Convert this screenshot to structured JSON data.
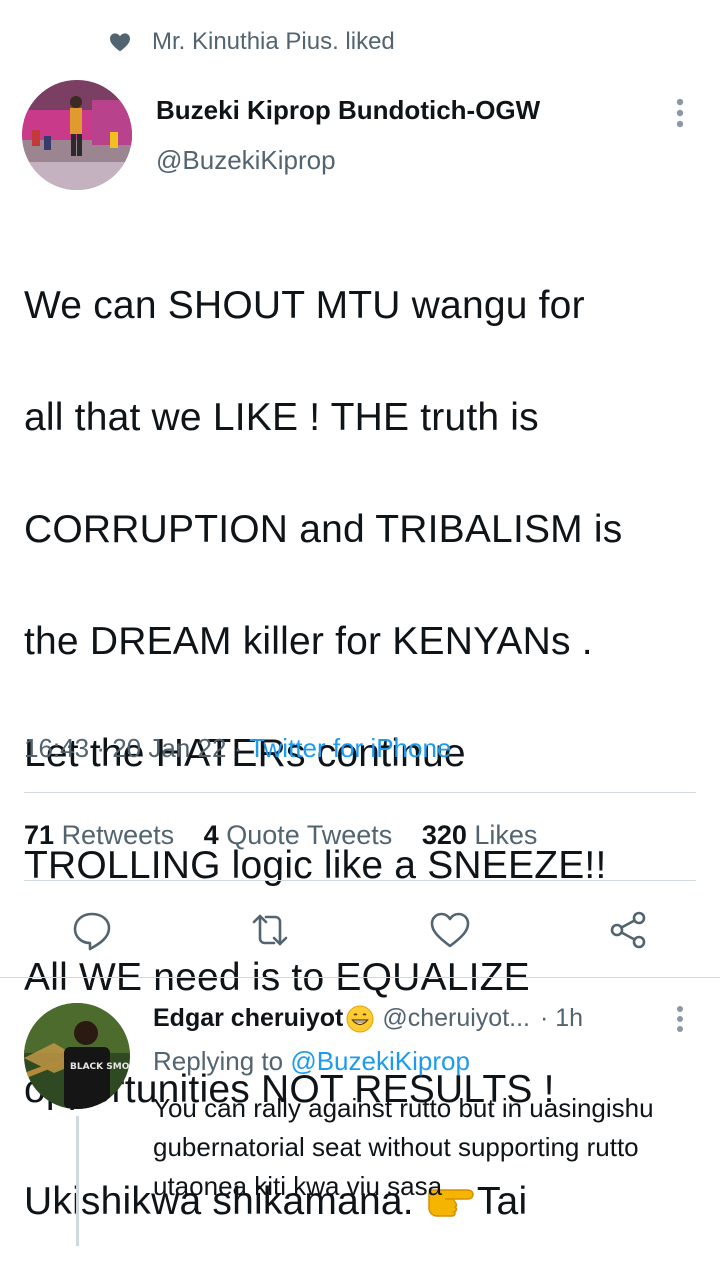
{
  "social_context": {
    "text": "Mr. Kinuthia Pius. liked"
  },
  "tweet": {
    "author_name": "Buzeki Kiprop Bundotich-OGW",
    "author_handle": "@BuzekiKiprop",
    "text_lines": [
      "We can SHOUT  MTU wangu  for",
      "all that we LIKE  ! THE truth is",
      "CORRUPTION  and TRIBALISM is",
      "the  DREAM killer for KENYANs .",
      "Let the HATERs  continue",
      "TROLLING logic  like a SNEEZE!!",
      "All WE need  is to EQUALIZE",
      "opportunities NOT RESULTS !",
      "Ukishikwa  shikamana. "
    ],
    "text_tail": "Tai",
    "time": "16:43",
    "date": "20 Jan 22",
    "source": "Twitter for iPhone",
    "retweets_count": "71",
    "retweets_label": "Retweets",
    "quotes_count": "4",
    "quotes_label": "Quote Tweets",
    "likes_count": "320",
    "likes_label": "Likes"
  },
  "actions": {
    "reply_icon": "reply-icon",
    "retweet_icon": "retweet-icon",
    "like_icon": "heart-icon",
    "share_icon": "share-icon"
  },
  "reply": {
    "author_name": "Edgar cheruiyot",
    "author_handle": "@cheruiyot...",
    "time": "· 1h",
    "replying_prefix": "Replying to ",
    "replying_to": "@BuzekiKiprop",
    "text": "You can rally against rutto but in uasingishu gubernatorial seat without supporting rutto utaonea kiti kwa viu sasa",
    "shirt_text": "BLACK SMOKE MATTERS"
  },
  "colors": {
    "accent": "#1d9bf0",
    "secondary_text": "#536471",
    "primary_text": "#0f1419",
    "divider": "#cfd9de"
  }
}
